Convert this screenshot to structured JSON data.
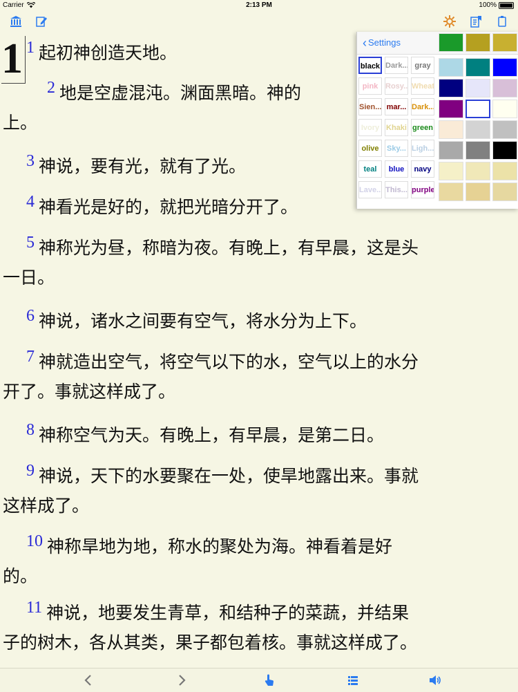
{
  "status_bar": {
    "carrier": "Carrier",
    "time": "2:13 PM",
    "battery": "100%"
  },
  "toolbar": {
    "left_icons": [
      "library-icon",
      "edit-icon"
    ],
    "right_icons": [
      "settings-icon",
      "bookmark-icon",
      "copy-icon"
    ]
  },
  "chapter": {
    "number": "1"
  },
  "verses": [
    {
      "num": "1",
      "text": "起初神创造天地。"
    },
    {
      "num": "2",
      "line1": "地是空虚混沌。渊面黑暗。神的",
      "line2": "上。"
    },
    {
      "num": "3",
      "text": "神说，要有光，就有了光。"
    },
    {
      "num": "4",
      "text": "神看光是好的，就把光暗分开了。"
    },
    {
      "num": "5",
      "line1": "神称光为昼，称暗为夜。有晚上，有早晨，这是头",
      "line2": "一日。"
    },
    {
      "num": "6",
      "text": "神说，诸水之间要有空气，将水分为上下。"
    },
    {
      "num": "7",
      "line1": "神就造出空气，将空气以下的水，空气以上的水分",
      "line2": "开了。事就这样成了。"
    },
    {
      "num": "8",
      "text": "神称空气为天。有晚上，有早晨，是第二日。"
    },
    {
      "num": "9",
      "line1": "神说，天下的水要聚在一处，使旱地露出来。事就",
      "line2": "这样成了。"
    },
    {
      "num": "10",
      "line1": "神称旱地为地，称水的聚处为海。神看着是好",
      "line2": "的。"
    },
    {
      "num": "11",
      "line1": "神说，地要发生青草，和结种子的菜蔬，并结果",
      "line2": "子的树木，各从其类，果子都包着核。事就这样成了。"
    }
  ],
  "settings_panel": {
    "back_label": "Settings",
    "color_names": [
      {
        "label": "black",
        "color": "#000000"
      },
      {
        "label": "Dark...",
        "color": "#9a9a9a"
      },
      {
        "label": "gray",
        "color": "#777777"
      },
      {
        "label": "pink",
        "color": "#f3b6c4"
      },
      {
        "label": "Rosy...",
        "color": "#e7d0d0"
      },
      {
        "label": "Wheat",
        "color": "#f0dcb0"
      },
      {
        "label": "Sien...",
        "color": "#a0522d"
      },
      {
        "label": "mar...",
        "color": "#800000"
      },
      {
        "label": "Dark...",
        "color": "#d8900a"
      },
      {
        "label": "Ivory",
        "color": "#eeeeda"
      },
      {
        "label": "Khaki",
        "color": "#e0d490"
      },
      {
        "label": "green",
        "color": "#1a8a1a"
      },
      {
        "label": "olive",
        "color": "#808000"
      },
      {
        "label": "Sky...",
        "color": "#9bcbe6"
      },
      {
        "label": "Ligh...",
        "color": "#b9cfe3"
      },
      {
        "label": "teal",
        "color": "#008080"
      },
      {
        "label": "blue",
        "color": "#1010c0"
      },
      {
        "label": "navy",
        "color": "#000080"
      },
      {
        "label": "Lave...",
        "color": "#d2d2e8"
      },
      {
        "label": "This...",
        "color": "#c0b8d0"
      },
      {
        "label": "purple",
        "color": "#800080"
      }
    ],
    "swatches": [
      "#add8e6",
      "#008080",
      "#0000ff",
      "#000080",
      "#e6e6fa",
      "#d8bfd8",
      "#800080",
      "#ffffff",
      "#fffff0",
      "#faebd7",
      "#d3d3d3",
      "#c0c0c0",
      "#a9a9a9",
      "#808080",
      "#000000",
      "#f5f0c8",
      "#f0e8b8",
      "#ece2a8",
      "#e9d9a0",
      "#e6d294",
      "#e6d8a0"
    ],
    "top_swatches": [
      "#1a9a2a",
      "#b5a020",
      "#c8b030"
    ]
  },
  "bottom_bar": {
    "icons": [
      "chevron-left-icon",
      "chevron-right-icon",
      "tap-icon",
      "list-icon",
      "speaker-icon"
    ]
  },
  "colors": {
    "background": "#f6f6e4",
    "verse_number": "#2a2ad6",
    "accent": "#2b7bf0"
  }
}
